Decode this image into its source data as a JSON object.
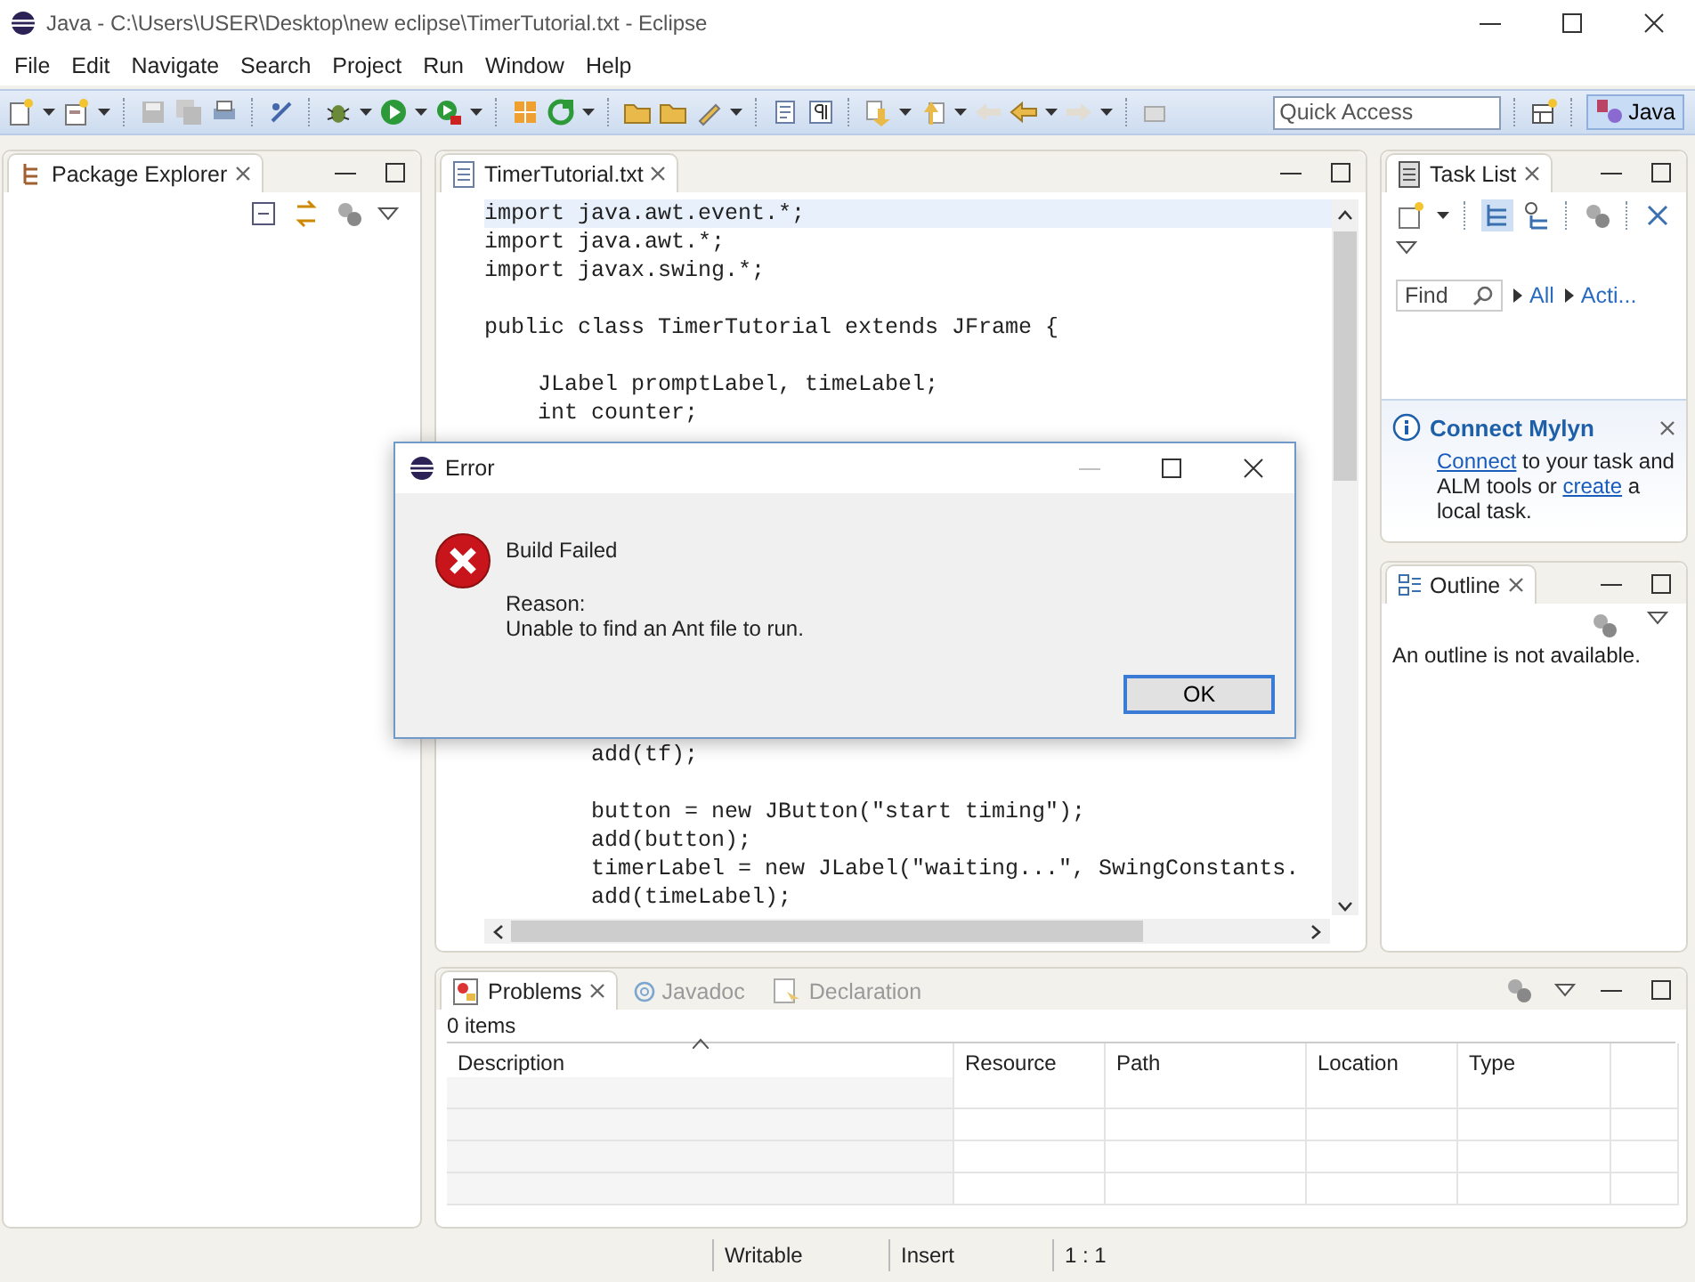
{
  "window": {
    "title": "Java - C:\\Users\\USER\\Desktop\\new eclipse\\TimerTutorial.txt - Eclipse"
  },
  "menu": [
    "File",
    "Edit",
    "Navigate",
    "Search",
    "Project",
    "Run",
    "Window",
    "Help"
  ],
  "toolbar": {
    "quick_access": {
      "placeholder": "Quick Access"
    },
    "perspectives": [
      {
        "label": "Java",
        "selected": true
      }
    ]
  },
  "package_explorer": {
    "tabs": [
      {
        "label": "Package Explorer",
        "selected": true
      }
    ]
  },
  "editor": {
    "tabs": [
      {
        "label": "TimerTutorial.txt",
        "selected": true
      }
    ],
    "code_top": [
      {
        "text": "import java.awt.event.*;",
        "current": true
      },
      {
        "text": "import java.awt.*;",
        "current": false
      },
      {
        "text": "import javax.swing.*;",
        "current": false
      },
      {
        "current": false
      },
      {
        "text": "public class TimerTutorial extends JFrame {",
        "current": false
      },
      {
        "current": false
      },
      {
        "text": "    JLabel promptLabel, timeLabel;",
        "current": false
      },
      {
        "text": "    int counter;",
        "current": false
      }
    ],
    "code_bottom": [
      {
        "text": "        add(tf);",
        "current": false
      },
      {
        "current": false
      },
      {
        "text": "        button = new JButton(\"start timing\");",
        "current": false
      },
      {
        "text": "        add(button);",
        "current": false
      },
      {
        "text": "        timerLabel = new JLabel(\"waiting...\", SwingConstants.",
        "current": false
      },
      {
        "text": "        add(timeLabel);",
        "current": false
      }
    ]
  },
  "task_list": {
    "tabs": [
      {
        "label": "Task List",
        "selected": true
      }
    ],
    "find": {
      "placeholder": "Find"
    },
    "filters": [
      "All",
      "Acti..."
    ],
    "mylyn": {
      "title": "Connect Mylyn",
      "text": [
        {
          "text": "Connect",
          "link": true
        },
        {
          "text": " to your task and ALM tools or ",
          "link": false
        },
        {
          "text": "create",
          "link": true
        },
        {
          "text": " a local task.",
          "link": false
        }
      ]
    }
  },
  "outline": {
    "tabs": [
      {
        "label": "Outline",
        "selected": true
      }
    ],
    "message": "An outline is not available."
  },
  "problems": {
    "tabs": [
      {
        "label": "Problems",
        "selected": true
      },
      {
        "label": "Javadoc",
        "selected": false
      },
      {
        "label": "Declaration",
        "selected": false
      }
    ],
    "count": "0 items",
    "columns": [
      "Description",
      "Resource",
      "Path",
      "Location",
      "Type"
    ]
  },
  "dialog": {
    "title": "Error",
    "heading": "Build Failed",
    "reason_label": "Reason:",
    "reason": "Unable to find an Ant file to run.",
    "buttons": [
      "OK"
    ]
  },
  "status_bar": [
    "Writable",
    "Insert",
    "1 : 1"
  ]
}
